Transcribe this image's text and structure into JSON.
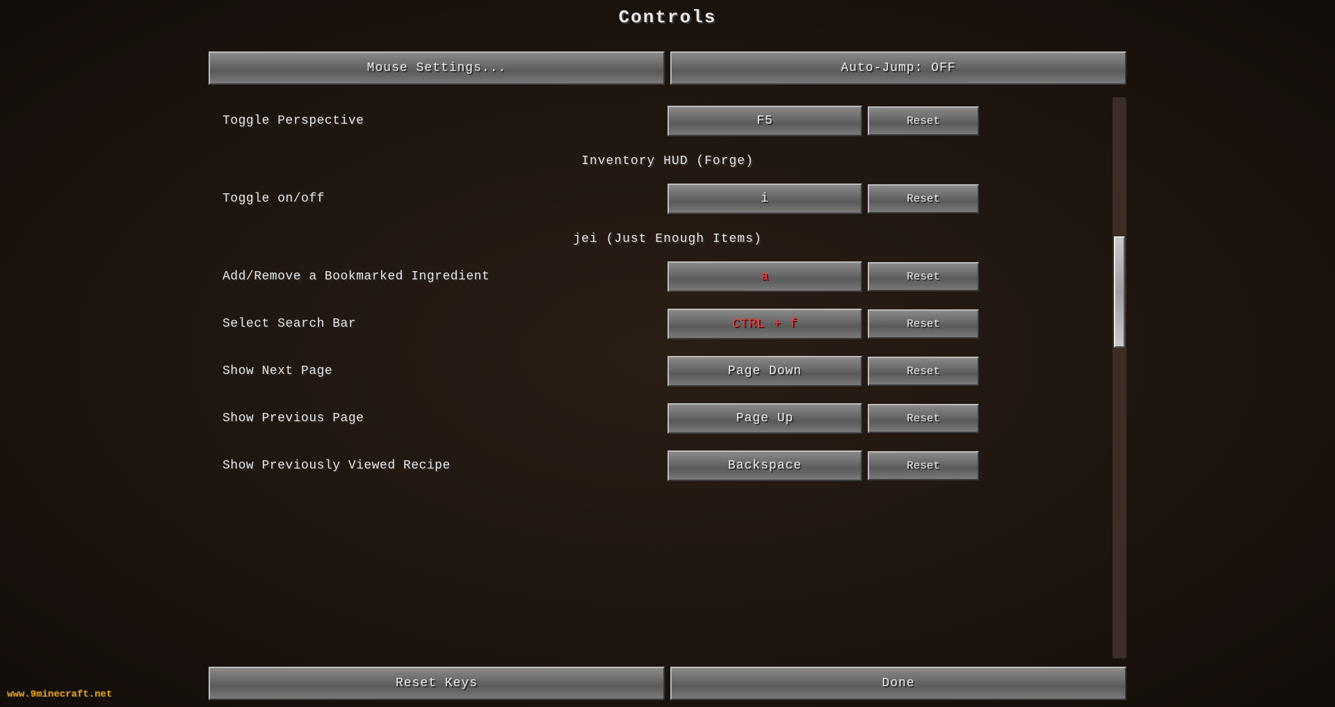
{
  "page": {
    "title": "Controls",
    "watermark": "www.9minecraft.net"
  },
  "top_buttons": {
    "mouse_settings": "Mouse Settings...",
    "auto_jump": "Auto-Jump: OFF"
  },
  "sections": [
    {
      "id": "misc",
      "header": null,
      "rows": [
        {
          "label": "Toggle Perspective",
          "key": "F5",
          "key_conflict": false,
          "reset_label": "Reset"
        }
      ]
    },
    {
      "id": "inventory_hud",
      "header": "Inventory HUD (Forge)",
      "rows": [
        {
          "label": "Toggle on/off",
          "key": "i",
          "key_conflict": false,
          "reset_label": "Reset"
        }
      ]
    },
    {
      "id": "jei",
      "header": "jei (Just Enough Items)",
      "rows": [
        {
          "label": "Add/Remove a Bookmarked Ingredient",
          "key": "a",
          "key_conflict": true,
          "reset_label": "Reset"
        },
        {
          "label": "Select Search Bar",
          "key": "CTRL + f",
          "key_conflict": true,
          "reset_label": "Reset"
        },
        {
          "label": "Show Next Page",
          "key": "Page Down",
          "key_conflict": false,
          "reset_label": "Reset"
        },
        {
          "label": "Show Previous Page",
          "key": "Page Up",
          "key_conflict": false,
          "reset_label": "Reset"
        },
        {
          "label": "Show Previously Viewed Recipe",
          "key": "Backspace",
          "key_conflict": false,
          "reset_label": "Reset"
        }
      ]
    }
  ],
  "bottom_buttons": {
    "reset_keys": "Reset Keys",
    "done": "Done"
  }
}
